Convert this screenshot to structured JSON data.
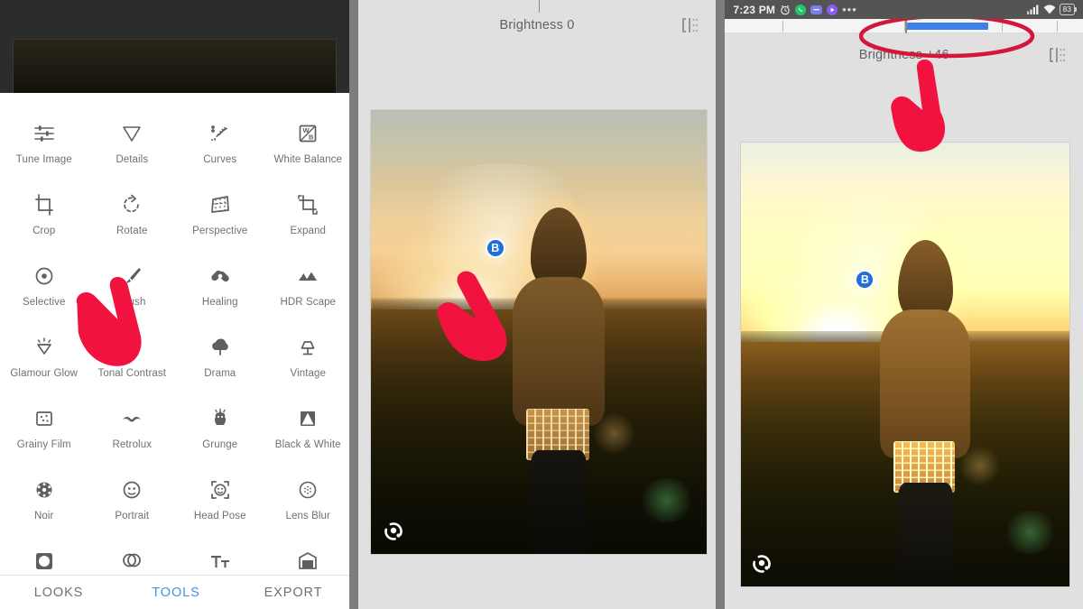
{
  "app": {
    "name": "Snapseed"
  },
  "panel_tools": {
    "grid_label": "tools-grid",
    "tools": [
      {
        "label": "Tune Image",
        "icon": "tune-image-icon"
      },
      {
        "label": "Details",
        "icon": "details-icon"
      },
      {
        "label": "Curves",
        "icon": "curves-icon"
      },
      {
        "label": "White Balance",
        "icon": "white-balance-icon"
      },
      {
        "label": "Crop",
        "icon": "crop-icon"
      },
      {
        "label": "Rotate",
        "icon": "rotate-icon"
      },
      {
        "label": "Perspective",
        "icon": "perspective-icon"
      },
      {
        "label": "Expand",
        "icon": "expand-icon"
      },
      {
        "label": "Selective",
        "icon": "selective-icon"
      },
      {
        "label": "Brush",
        "icon": "brush-icon"
      },
      {
        "label": "Healing",
        "icon": "healing-icon"
      },
      {
        "label": "HDR Scape",
        "icon": "hdr-scape-icon"
      },
      {
        "label": "Glamour Glow",
        "icon": "glamour-glow-icon"
      },
      {
        "label": "Tonal Contrast",
        "icon": "tonal-contrast-icon"
      },
      {
        "label": "Drama",
        "icon": "drama-icon"
      },
      {
        "label": "Vintage",
        "icon": "vintage-icon"
      },
      {
        "label": "Grainy Film",
        "icon": "grainy-film-icon"
      },
      {
        "label": "Retrolux",
        "icon": "retrolux-icon"
      },
      {
        "label": "Grunge",
        "icon": "grunge-icon"
      },
      {
        "label": "Black & White",
        "icon": "black-and-white-icon"
      },
      {
        "label": "Noir",
        "icon": "noir-icon"
      },
      {
        "label": "Portrait",
        "icon": "portrait-icon"
      },
      {
        "label": "Head Pose",
        "icon": "head-pose-icon"
      },
      {
        "label": "Lens Blur",
        "icon": "lens-blur-icon"
      },
      {
        "label": "Vignette",
        "icon": "vignette-icon"
      },
      {
        "label": "Double Exposure",
        "icon": "double-exposure-icon"
      },
      {
        "label": "Text",
        "icon": "text-icon"
      },
      {
        "label": "Frames",
        "icon": "frames-icon"
      }
    ],
    "bottom_nav": [
      {
        "label": "LOOKS",
        "active": false
      },
      {
        "label": "TOOLS",
        "active": true
      },
      {
        "label": "EXPORT",
        "active": false
      }
    ],
    "accent_color": "#4a90e2"
  },
  "panel_before": {
    "tool_title": "Brightness 0",
    "brightness_value": 0,
    "slider_percent": 50,
    "control_point_label": "B",
    "compare_icon": "compare-split-icon",
    "lens_icon": "google-lens-icon"
  },
  "panel_after": {
    "statusbar": {
      "time": "7:23 PM",
      "icons": [
        "alarm-icon",
        "whatsapp-icon",
        "message-icon",
        "play-icon",
        "more-icon"
      ],
      "signal_icon": "signal-bars-icon",
      "wifi_icon": "wifi-icon",
      "battery_level": "83"
    },
    "tool_title": "Brightness +46",
    "brightness_value": 46,
    "slider_percent": 73,
    "control_point_label": "B",
    "compare_icon": "compare-split-icon",
    "lens_icon": "google-lens-icon",
    "annotation_color": "#e3143c"
  }
}
